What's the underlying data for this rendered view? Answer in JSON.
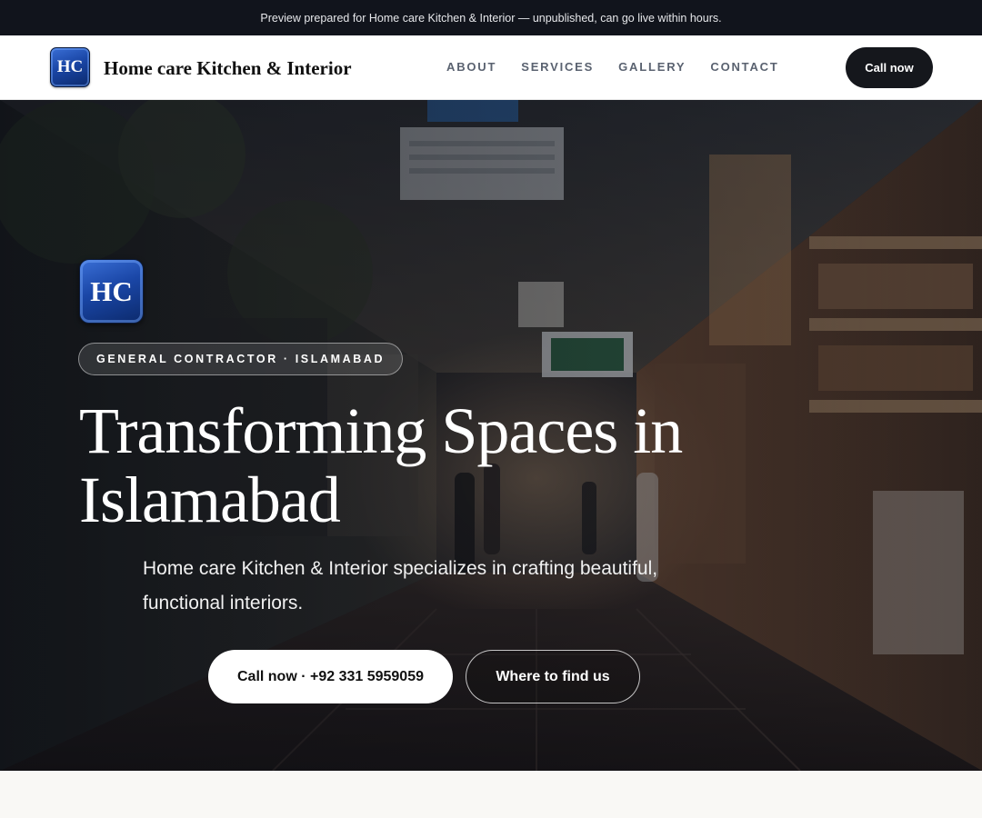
{
  "preview_bar": {
    "text": "Preview prepared for Home care Kitchen & Interior — unpublished, can go live within hours."
  },
  "header": {
    "logo_text": "HC",
    "brand_name": "Home care Kitchen & Interior",
    "nav": [
      {
        "label": "ABOUT"
      },
      {
        "label": "SERVICES"
      },
      {
        "label": "GALLERY"
      },
      {
        "label": "CONTACT"
      }
    ],
    "call_button": "Call now"
  },
  "hero": {
    "logo_text": "HC",
    "badge": "GENERAL CONTRACTOR · ISLAMABAD",
    "title": "Transforming Spaces in Islamabad",
    "subtitle": "Home care Kitchen & Interior specializes in crafting beautiful, functional interiors.",
    "primary_button": "Call now · +92 331 5959059",
    "secondary_button": "Where to find us",
    "background_image": "photo of a narrow covered market aisle with shops and people"
  },
  "colors": {
    "preview_bar_bg": "#11141c",
    "header_bg": "#ffffff",
    "dark_button": "#15171c",
    "logo_blue": "#1a46a6",
    "page_bg": "#f9f8f5"
  }
}
